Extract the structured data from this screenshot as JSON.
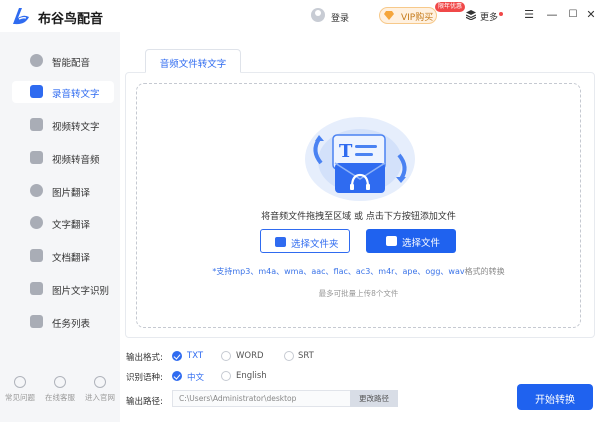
{
  "app": {
    "title": "布谷鸟配音"
  },
  "header": {
    "login_label": "登录",
    "vip_label": "VIP购买",
    "vip_badge": "限年优惠",
    "more_label": "更多",
    "window_buttons": [
      "☰",
      "—",
      "☐",
      "✕"
    ]
  },
  "sidebar": {
    "items": [
      {
        "label": "智能配音",
        "active": false,
        "icon": "microphone-icon"
      },
      {
        "label": "录音转文字",
        "active": true,
        "icon": "audio-to-text-icon"
      },
      {
        "label": "视频转文字",
        "active": false,
        "icon": "video-icon"
      },
      {
        "label": "视频转音频",
        "active": false,
        "icon": "video-audio-icon"
      },
      {
        "label": "图片翻译",
        "active": false,
        "icon": "image-translate-icon"
      },
      {
        "label": "文字翻译",
        "active": false,
        "icon": "text-translate-icon"
      },
      {
        "label": "文档翻译",
        "active": false,
        "icon": "doc-translate-icon"
      },
      {
        "label": "图片文字识别",
        "active": false,
        "icon": "ocr-icon"
      },
      {
        "label": "任务列表",
        "active": false,
        "icon": "task-list-icon"
      }
    ],
    "footer": [
      {
        "label": "常见问题",
        "icon": "help-icon"
      },
      {
        "label": "在线客服",
        "icon": "service-icon"
      },
      {
        "label": "进入官网",
        "icon": "website-icon"
      }
    ]
  },
  "main": {
    "tab_label": "音频文件转文字",
    "drop_hint": "将音频文件拖拽至区域 或 点击下方按钮添加文件",
    "select_folder_label": "选择文件夹",
    "select_file_label": "选择文件",
    "formats_text": "*支持mp3、m4a、wma、aac、flac、ac3、m4r、ape、ogg、wav",
    "formats_suffix": "格式的转换",
    "limit_text": "最多可批量上传8个文件"
  },
  "options": {
    "output_format_label": "输出格式:",
    "output_formats": [
      {
        "label": "TXT",
        "checked": true
      },
      {
        "label": "WORD",
        "checked": false
      },
      {
        "label": "SRT",
        "checked": false
      }
    ],
    "language_label": "识别语种:",
    "languages": [
      {
        "label": "中文",
        "checked": true
      },
      {
        "label": "English",
        "checked": false
      }
    ],
    "output_path_label": "输出路径:",
    "output_path_value": "C:\\Users\\Administrator\\desktop",
    "change_path_label": "更改路径"
  },
  "start_label": "开始转换",
  "colors": {
    "accent": "#2f6bf0",
    "sidebar_bg": "#f5f6f8",
    "vip_text": "#c47a1a",
    "badge": "#f04848"
  }
}
